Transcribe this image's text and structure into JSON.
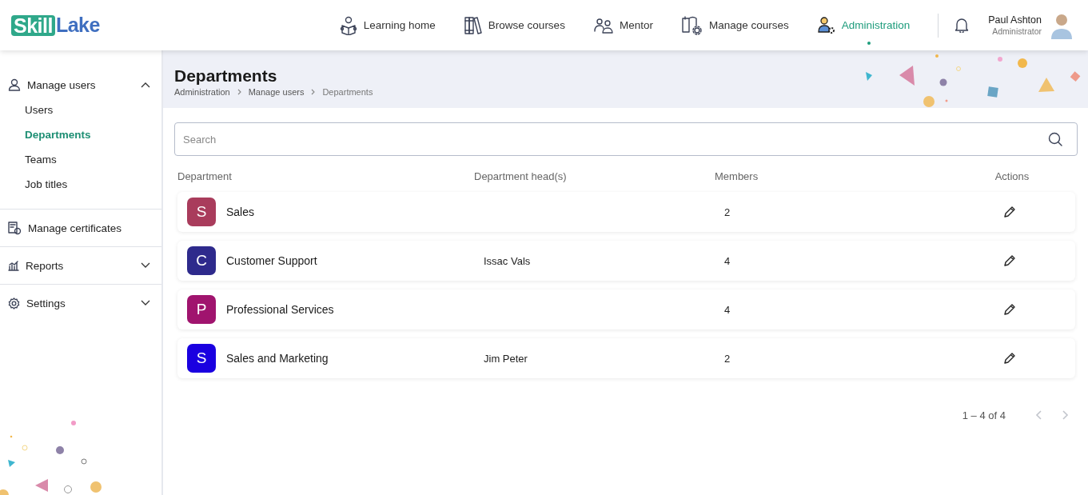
{
  "logo": {
    "first": "Skill",
    "second": "Lake"
  },
  "nav": [
    {
      "label": "Learning home",
      "selected": false
    },
    {
      "label": "Browse courses",
      "selected": false
    },
    {
      "label": "Mentor",
      "selected": false
    },
    {
      "label": "Manage courses",
      "selected": false
    },
    {
      "label": "Administration",
      "selected": true
    }
  ],
  "user": {
    "name": "Paul Ashton",
    "role": "Administrator"
  },
  "sidebar": [
    {
      "label": "Manage users",
      "kind": "group",
      "expanded": true,
      "children": [
        {
          "label": "Users",
          "selected": false
        },
        {
          "label": "Departments",
          "selected": true
        },
        {
          "label": "Teams",
          "selected": false
        },
        {
          "label": "Job titles",
          "selected": false
        }
      ]
    },
    {
      "label": "Manage certificates",
      "kind": "link"
    },
    {
      "label": "Reports",
      "kind": "group",
      "expanded": false
    },
    {
      "label": "Settings",
      "kind": "group",
      "expanded": false
    }
  ],
  "page": {
    "title": "Departments",
    "breadcrumb": [
      "Administration",
      "Manage users",
      "Departments"
    ]
  },
  "search": {
    "placeholder": "Search"
  },
  "table": {
    "columns": [
      "Department",
      "Department head(s)",
      "Members",
      "Actions"
    ],
    "rows": [
      {
        "initial": "S",
        "color": "#a93c5c",
        "name": "Sales",
        "head": "",
        "members": "2"
      },
      {
        "initial": "C",
        "color": "#2e2a8c",
        "name": "Customer Support",
        "head": "Issac Vals",
        "members": "4"
      },
      {
        "initial": "P",
        "color": "#a0146e",
        "name": "Professional Services",
        "head": "",
        "members": "4"
      },
      {
        "initial": "S",
        "color": "#1a00e0",
        "name": "Sales and Marketing",
        "head": "Jim Peter",
        "members": "2"
      }
    ]
  },
  "pagination": {
    "range": "1 – 4 of 4",
    "prev_disabled": true,
    "next_disabled": true
  }
}
